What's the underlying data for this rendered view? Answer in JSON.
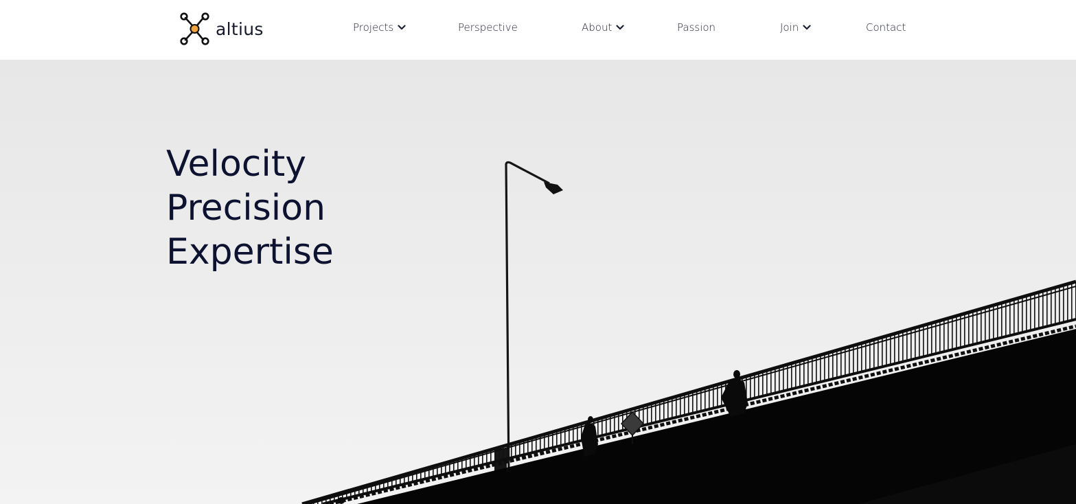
{
  "brand": {
    "name": "altius",
    "accent": "#f2a33a",
    "logo_icon": "molecule-logo-icon"
  },
  "nav": {
    "items": [
      {
        "label": "Projects",
        "has_dropdown": true
      },
      {
        "label": "Perspective",
        "has_dropdown": false
      },
      {
        "label": "About",
        "has_dropdown": true
      },
      {
        "label": "Passion",
        "has_dropdown": false
      },
      {
        "label": "Join",
        "has_dropdown": true
      },
      {
        "label": "Contact",
        "has_dropdown": false
      }
    ]
  },
  "hero": {
    "headline": [
      "Velocity",
      "Precision",
      "Expertise"
    ],
    "image_subject": "bridge-silhouette-with-street-lamp-and-pedestrians",
    "text_color": "#0d1230"
  }
}
